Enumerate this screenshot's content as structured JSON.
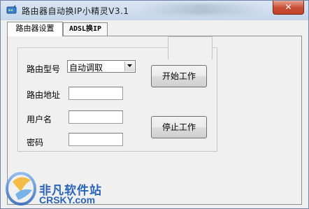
{
  "window": {
    "title": "路由器自动换IP小精灵V3.1",
    "close_label": "✕"
  },
  "tabs": [
    {
      "label": "路由器设置",
      "active": true
    },
    {
      "label": "ADSL换IP",
      "active": false
    }
  ],
  "form": {
    "router_model_label": "路由型号",
    "router_model_value": "自动调取",
    "router_address_label": "路由地址",
    "router_address_value": "",
    "username_label": "用户名",
    "username_value": "",
    "password_label": "密码",
    "password_value": ""
  },
  "buttons": {
    "start_label": "开始工作",
    "stop_label": "停止工作"
  },
  "watermark": {
    "text_cn": "非凡软件站",
    "text_en": "CRSKY.com"
  },
  "colors": {
    "accent": "#2a64b8",
    "close": "#c74b31"
  }
}
